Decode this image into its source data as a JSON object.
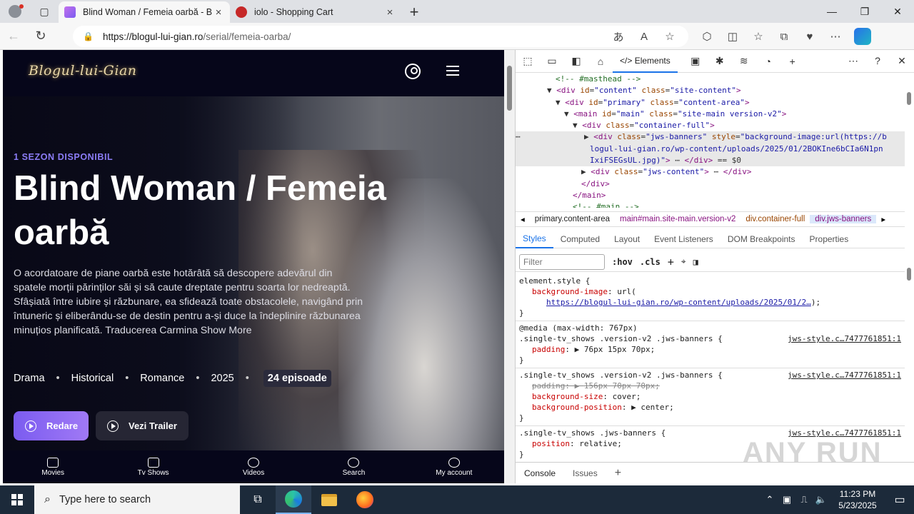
{
  "browser": {
    "tabs": [
      {
        "title": "Blind Woman / Femeia oarbă - B",
        "active": true
      },
      {
        "title": "iolo - Shopping Cart",
        "active": false
      }
    ],
    "url_host": "https://blogul-lui-gian.ro",
    "url_path": "/serial/femeia-oarba/"
  },
  "site": {
    "logo": "Blogul-lui-Gian",
    "season": "1 SEZON DISPONIBIL",
    "title": "Blind Woman / Femeia oarbă",
    "description": "O acordatoare de piane oarbă este hotărâtă să descopere adevărul din spatele morții părinților săi și să caute dreptate pentru soarta lor nedreaptă. Sfâșiată între iubire și răzbunare, ea sfidează toate obstacolele, navigând prin întuneric și eliberându-se de destin pentru a-și duce la îndeplinire răzbunarea minuțios planificată. Traducerea Carmina Show More",
    "genres": [
      "Drama",
      "Historical",
      "Romance",
      "2025"
    ],
    "episodes": "24 episoade",
    "play_label": "Redare",
    "trailer_label": "Vezi Trailer",
    "bottom_nav": [
      "Movies",
      "Tv Shows",
      "Videos",
      "Search",
      "My account"
    ]
  },
  "devtools": {
    "elements_tab": "Elements",
    "breadcrumbs": [
      "primary.content-area",
      "main#main.site-main.version-v2",
      "div.container-full",
      "div.jws-banners"
    ],
    "subtabs": [
      "Styles",
      "Computed",
      "Layout",
      "Event Listeners",
      "DOM Breakpoints",
      "Properties"
    ],
    "filter_placeholder": "Filter",
    "hov": ":hov",
    "cls": ".cls",
    "drawer_tabs": [
      "Console",
      "Issues"
    ],
    "styles": {
      "element_style": "element.style {",
      "bg_prop": "background-image",
      "bg_val": "url(",
      "bg_url": "https://blogul-lui-gian.ro/wp-content/uploads/2025/01/2…",
      "media": "@media (max-width: 767px)",
      "sel1": ".single-tv_shows .version-v2 .jws-banners {",
      "src": "jws-style.c…7477761851:1",
      "padding1": "76px 15px 70px;",
      "sel2": ".single-tv_shows .version-v2 .jws-banners {",
      "padding2": "156px 70px 70px;",
      "bgsize": "cover;",
      "bgpos": "center;",
      "sel3": ".single-tv_shows .jws-banners {",
      "position": "relative;"
    }
  },
  "taskbar": {
    "search_placeholder": "Type here to search",
    "time": "11:23 PM",
    "date": "5/23/2025"
  },
  "watermark": "ANY RUN"
}
